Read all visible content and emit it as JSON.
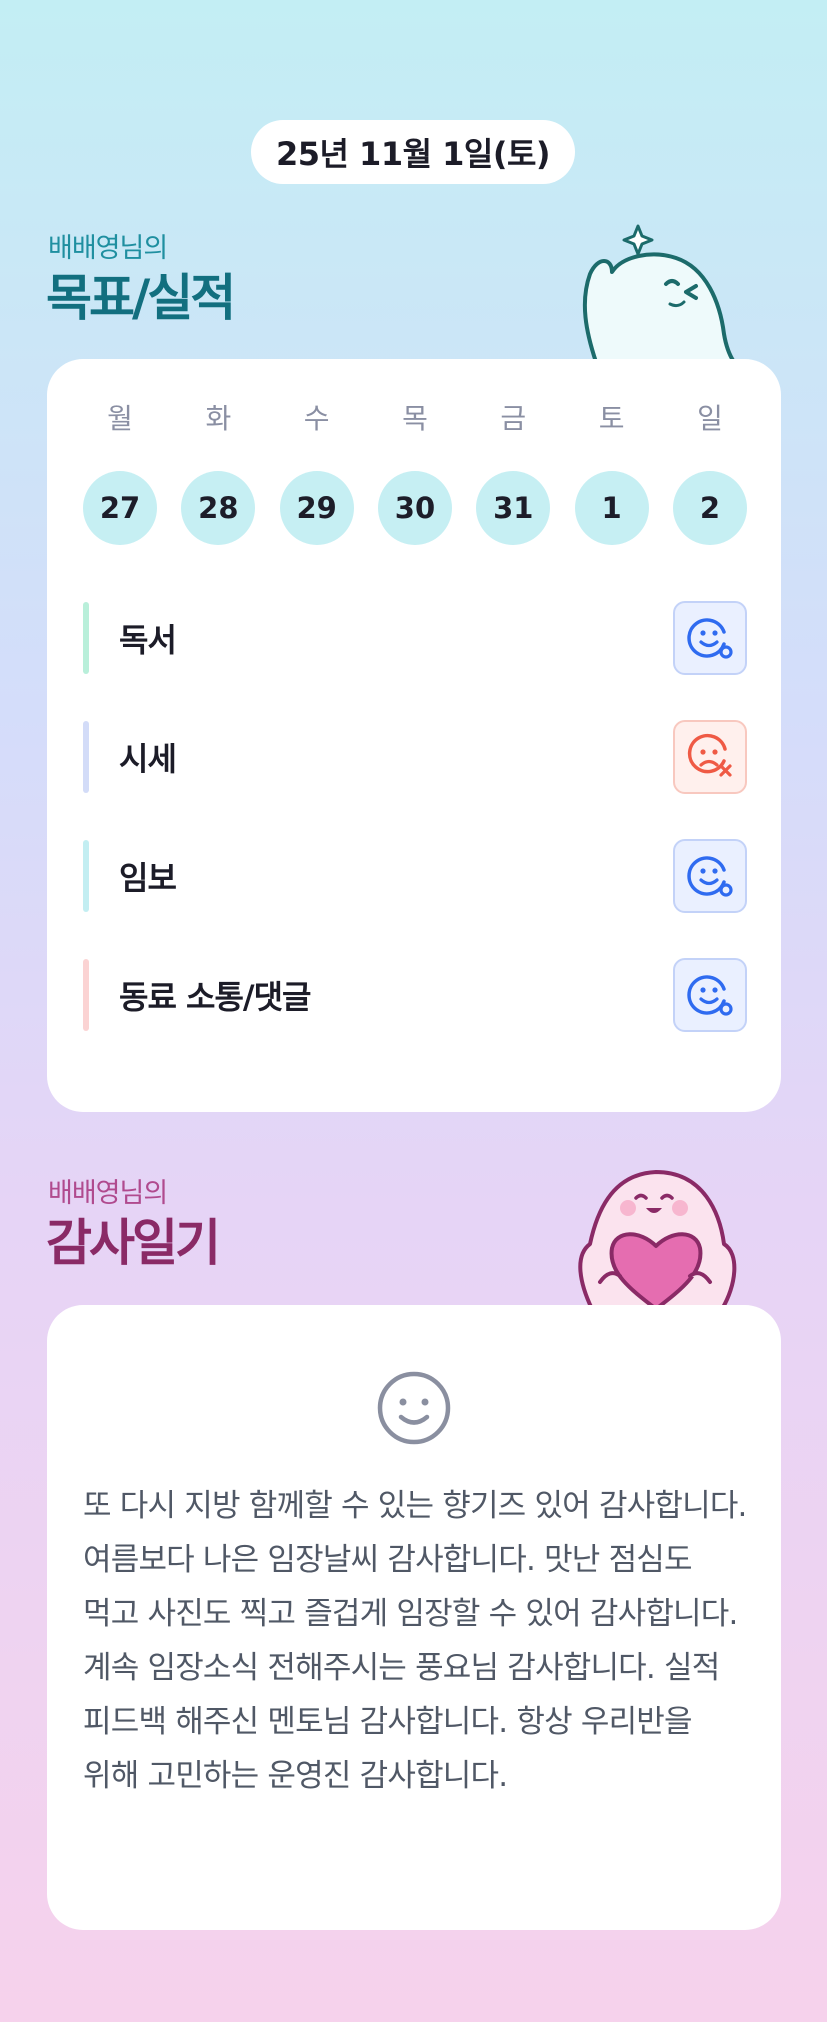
{
  "header": {
    "date": "25년 11월 1일(토)"
  },
  "goals_section": {
    "subtitle": "배배영님의",
    "title": "목표/실적",
    "days": [
      {
        "name": "월",
        "num": "27"
      },
      {
        "name": "화",
        "num": "28"
      },
      {
        "name": "수",
        "num": "29"
      },
      {
        "name": "목",
        "num": "30"
      },
      {
        "name": "금",
        "num": "31"
      },
      {
        "name": "토",
        "num": "1"
      },
      {
        "name": "일",
        "num": "2"
      }
    ],
    "goals": [
      {
        "label": "독서",
        "status": "done",
        "bar_color": "#b9efda"
      },
      {
        "label": "시세",
        "status": "missed",
        "bar_color": "#d3dcf8"
      },
      {
        "label": "임보",
        "status": "done",
        "bar_color": "#c3eef2"
      },
      {
        "label": "동료 소통/댓글",
        "status": "done",
        "bar_color": "#fbd3d3"
      }
    ]
  },
  "thanks_section": {
    "subtitle": "배배영님의",
    "title": "감사일기",
    "mood_icon": "smile-face-icon",
    "text": "또 다시 지방 함께할 수 있는 향기즈 있어 감사합니다. 여름보다 나은 임장날씨 감사합니다. 맛난 점심도 먹고 사진도 찍고 즐겁게 임장할 수 있어 감사합니다. 계속 임장소식 전해주시는 풍요님 감사합니다. 실적 피드백 해주신 멘토님 감사합니다. 항상 우리반을 위해 고민하는 운영진 감사합니다."
  },
  "colors": {
    "done": "#2f6bf0",
    "missed": "#ef5a45",
    "goal_title": "#126f7f",
    "thanks_title": "#8a2a66"
  }
}
